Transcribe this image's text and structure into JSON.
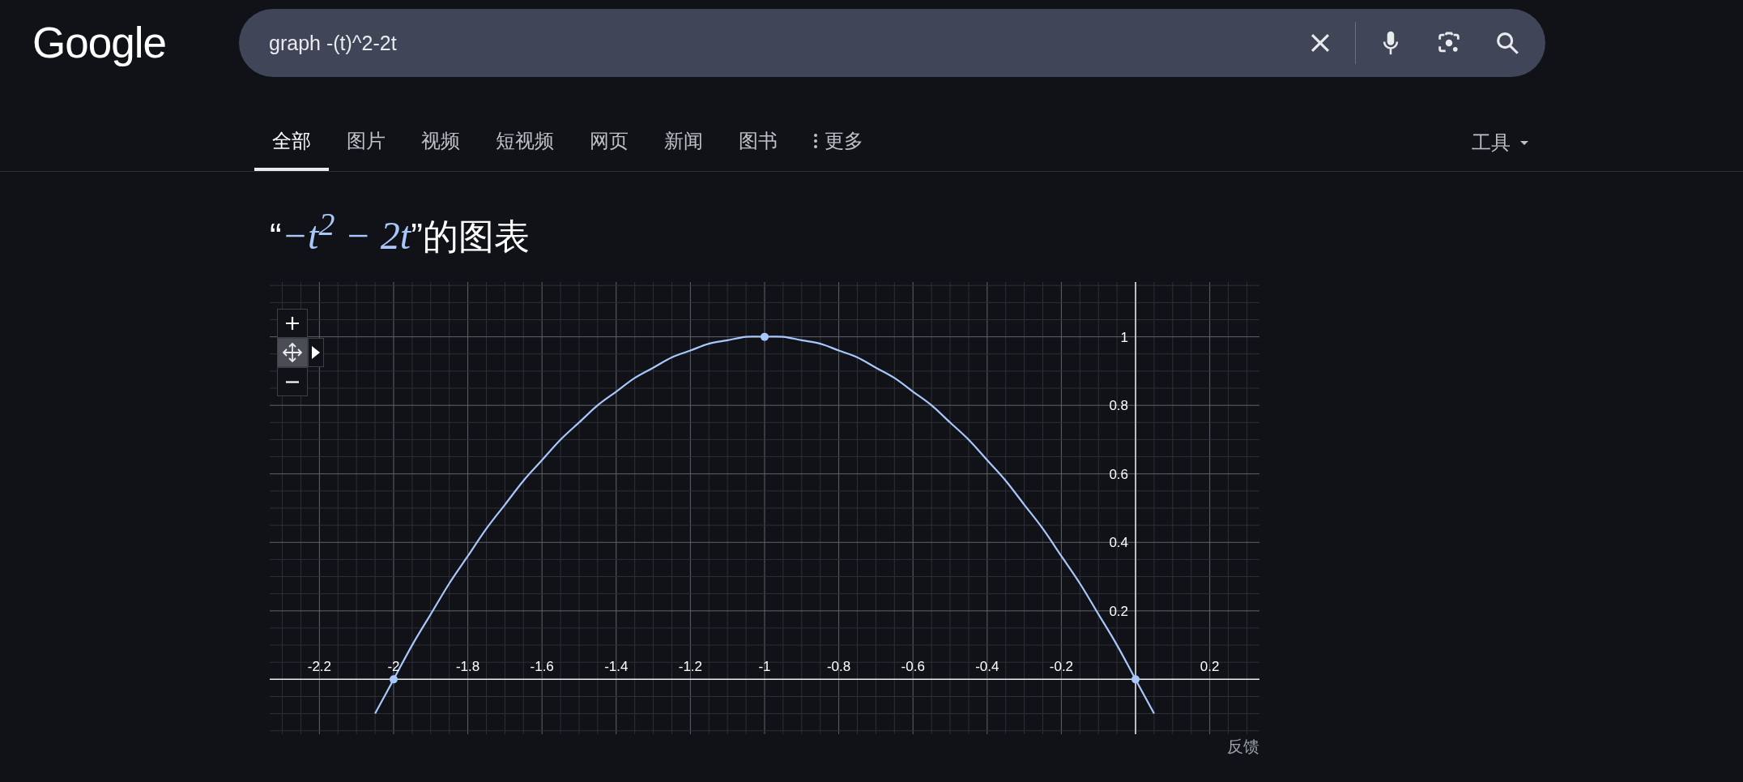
{
  "logo": {
    "text": "Google"
  },
  "search": {
    "value": "graph -(t)^2-2t"
  },
  "tabs": [
    {
      "label": "全部",
      "selected": true,
      "kind": "tab"
    },
    {
      "label": "图片",
      "selected": false,
      "kind": "tab"
    },
    {
      "label": "视频",
      "selected": false,
      "kind": "tab"
    },
    {
      "label": "短视频",
      "selected": false,
      "kind": "tab"
    },
    {
      "label": "网页",
      "selected": false,
      "kind": "tab"
    },
    {
      "label": "新闻",
      "selected": false,
      "kind": "tab"
    },
    {
      "label": "图书",
      "selected": false,
      "kind": "tab"
    },
    {
      "label": "更多",
      "selected": false,
      "kind": "menu"
    }
  ],
  "tools": {
    "label": "工具"
  },
  "result": {
    "title": {
      "open_quote": "“",
      "expression": "−t$^{2}$ − 2t",
      "rest": "”的图表"
    },
    "chart_data": {
      "type": "line",
      "grid": true,
      "x": [
        -2.05,
        -2,
        -1.95,
        -1.9,
        -1.85,
        -1.8,
        -1.75,
        -1.7,
        -1.65,
        -1.6,
        -1.55,
        -1.5,
        -1.45,
        -1.4,
        -1.35,
        -1.3,
        -1.25,
        -1.2,
        -1.15,
        -1.1,
        -1.05,
        -1,
        -0.95,
        -0.9,
        -0.85,
        -0.8,
        -0.75,
        -0.7,
        -0.65,
        -0.6,
        -0.55,
        -0.5,
        -0.45,
        -0.4,
        -0.35,
        -0.3,
        -0.25,
        -0.2,
        -0.15,
        -0.1,
        -0.05,
        0,
        0.05
      ],
      "series": [
        {
          "color": "#a8c7fa",
          "values": [
            -0.1,
            0,
            0.1,
            0.19,
            0.28,
            0.36,
            0.44,
            0.51,
            0.58,
            0.64,
            0.7,
            0.75,
            0.8,
            0.84,
            0.88,
            0.91,
            0.94,
            0.96,
            0.98,
            0.99,
            1,
            1,
            1,
            0.99,
            0.98,
            0.96,
            0.94,
            0.91,
            0.88,
            0.84,
            0.8,
            0.75,
            0.7,
            0.64,
            0.58,
            0.51,
            0.44,
            0.36,
            0.28,
            0.19,
            0.1,
            0,
            -0.1
          ]
        }
      ],
      "xlim": [
        -2.334,
        0.334
      ],
      "ylim": [
        -0.16,
        1.16
      ],
      "xticks": [
        {
          "value": -2.2,
          "label": "-2.2"
        },
        {
          "value": -2,
          "label": "-2"
        },
        {
          "value": -1.8,
          "label": "-1.8"
        },
        {
          "value": -1.6,
          "label": "-1.6"
        },
        {
          "value": -1.4,
          "label": "-1.4"
        },
        {
          "value": -1.2,
          "label": "-1.2"
        },
        {
          "value": -1,
          "label": "-1"
        },
        {
          "value": -0.8,
          "label": "-0.8"
        },
        {
          "value": -0.6,
          "label": "-0.6"
        },
        {
          "value": -0.4,
          "label": "-0.4"
        },
        {
          "value": -0.2,
          "label": "-0.2"
        },
        {
          "value": 0.2,
          "label": "0.2"
        }
      ],
      "yticks": [
        {
          "value": 0.2,
          "label": "0.2"
        },
        {
          "value": 0.4,
          "label": "0.4"
        },
        {
          "value": 0.6,
          "label": "0.6"
        },
        {
          "value": 0.8,
          "label": "0.8"
        },
        {
          "value": 1,
          "label": "1"
        }
      ]
    },
    "feedback": "反馈"
  }
}
